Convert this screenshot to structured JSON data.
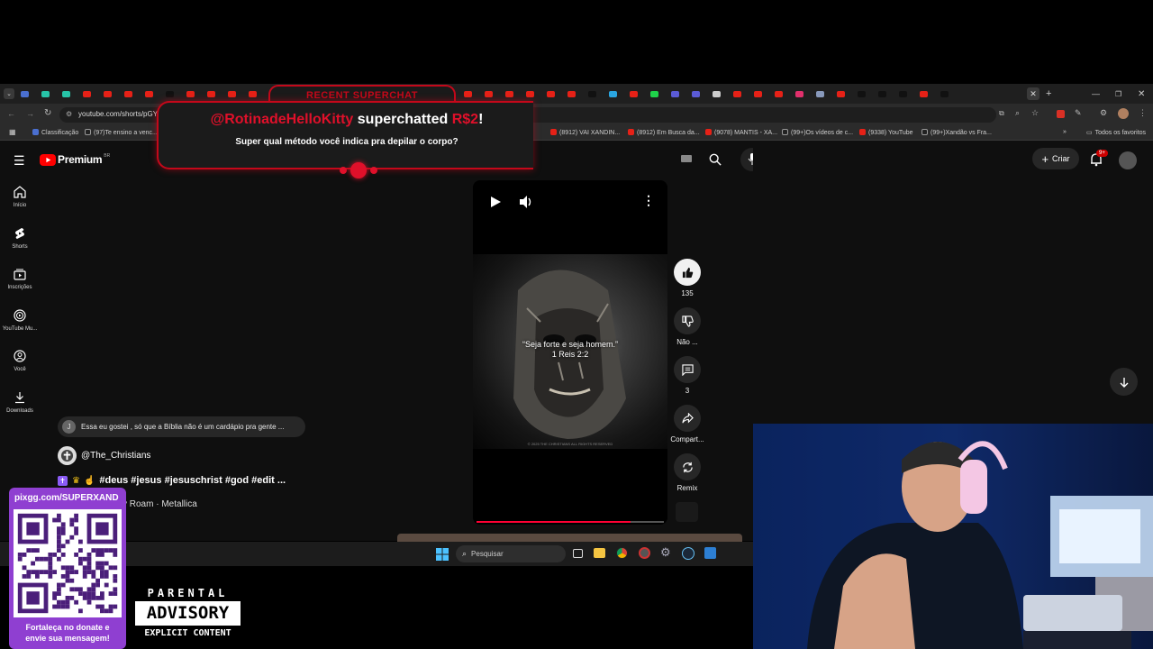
{
  "browser": {
    "url": "youtube.com/shorts/pGY",
    "bookmarks": [
      {
        "label": "Classificação"
      },
      {
        "label": "(97)Te ensino a venc..."
      },
      {
        "label": "(8912) VAI XANDIN..."
      },
      {
        "label": "(8912) Em Busca da..."
      },
      {
        "label": "(9078) MANTIS - XA..."
      },
      {
        "label": "(99+)Os vídeos de c..."
      },
      {
        "label": "(9338) YouTube"
      },
      {
        "label": "(99+)Xandão vs Fra..."
      }
    ],
    "favorites_label": "Todos os favoritos"
  },
  "youtube": {
    "logo_text": "Premium",
    "logo_region": "BR",
    "create_label": "Criar",
    "notif_count": "9+",
    "sidebar": [
      {
        "label": "Início",
        "icon": "home-icon"
      },
      {
        "label": "Shorts",
        "icon": "shorts-icon"
      },
      {
        "label": "Inscrições",
        "icon": "subscriptions-icon"
      },
      {
        "label": "YouTube Mu...",
        "icon": "youtube-music-icon"
      },
      {
        "label": "Você",
        "icon": "you-icon"
      },
      {
        "label": "Downloads",
        "icon": "download-icon"
      }
    ],
    "comment": {
      "avatar_letter": "J",
      "text": "Essa eu gostei , só que a Bíblia não é um cardápio pra gente ..."
    },
    "channel": "@The_Christians",
    "title": "#deus #jesus #jesuschrist #god #edit ...",
    "music": "y Roam · Metallica",
    "video_caption_line1": "“Seja forte e seja homem.”",
    "video_caption_line2": "1 Reis 2:2",
    "video_watermark": "© 2025 THE CHRISTIANS ALL RIGHTS RESERVED",
    "progress": 0.82,
    "actions": {
      "likes": "135",
      "dislike_label": "Não ...",
      "comments": "3",
      "share_label": "Compart...",
      "remix_label": "Remix"
    }
  },
  "superchat": {
    "header": "RECENT SUPERCHAT",
    "user": "@RotinadeHelloKitty",
    "action": "superchatted",
    "amount": "R$2",
    "exclaim": "!",
    "message": "Super qual método você indica pra depilar o corpo?"
  },
  "taskbar": {
    "search_placeholder": "Pesquisar"
  },
  "stream": {
    "donate_url": "pixgg.com/SUPERXAND",
    "donate_text_line1": "Fortaleça no donate e",
    "donate_text_line2": "envie sua mensagem!",
    "advisory_top": "PARENTAL",
    "advisory_mid": "ADVISORY",
    "advisory_bottom": "EXPLICIT CONTENT"
  },
  "colors": {
    "accent_red": "#e62117",
    "superchat_red": "#c4081a",
    "donate_purple": "#8f3fd1"
  }
}
